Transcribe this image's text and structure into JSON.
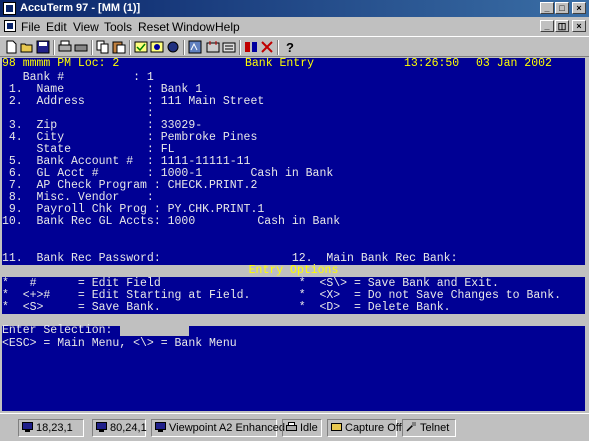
{
  "window": {
    "title": "AccuTerm 97 - [MM (1)]"
  },
  "window_buttons": {
    "minimize": "_",
    "maximize": "□",
    "close": "×"
  },
  "mdi_buttons": {
    "minimize": "_",
    "restore": "◫",
    "close": "×"
  },
  "menu": [
    "File",
    "Edit",
    "View",
    "Tools",
    "Reset",
    "Window",
    "Help"
  ],
  "toolbar": {
    "icons": [
      "new-icon",
      "open-icon",
      "save-icon",
      "print-icon",
      "printer-setup-icon",
      "copy-icon",
      "paste-icon",
      "capture-icon",
      "settings-icon",
      "macro-icon",
      "connect-icon",
      "disconnect-icon",
      "transfer-icon",
      "keyboard-icon",
      "help-icon"
    ]
  },
  "terminal": {
    "status_left": "98 mmmm PM Loc: 2",
    "status_center": "Bank Entry",
    "status_time": "13:26:50",
    "status_date": "03 Jan 2002",
    "lines": [
      "   Bank #          : 1",
      " 1.  Name            : Bank 1",
      " 2.  Address         : 111 Main Street",
      "                     :",
      " 3.  Zip             : 33029-",
      " 4.  City            : Pembroke Pines",
      "     State           : FL",
      " 5.  Bank Account #  : 1111-11111-11",
      " 6.  GL Acct #       : 1000-1       Cash in Bank",
      " 7.  AP Check Program : CHECK.PRINT.2",
      " 8.  Misc. Vendor    :",
      " 9.  Payroll Chk Prog : PY.CHK.PRINT.1",
      "10.  Bank Rec GL Accts: 1000         Cash in Bank"
    ],
    "password_line": "11.  Bank Rec Password:                   12.  Main Bank Rec Bank:",
    "entry_options_title": "Entry Options",
    "options": [
      "*   #      = Edit Field                    *  <S\\> = Save Bank and Exit.",
      "*  <+>#    = Edit Starting at Field.       *  <X>  = Do not Save Changes to Bank.",
      "*  <S>     = Save Bank.                    *  <D>  = Delete Bank."
    ],
    "prompt": "Enter Selection:",
    "selection_value": "",
    "help_line": "<ESC> = Main Menu, <\\> = Bank Menu"
  },
  "statusbar": {
    "cursor_pos": "18,23,1",
    "screen_size": "80,24,1",
    "emulation": "Viewpoint A2 Enhanced",
    "state": "Idle",
    "capture": "Capture Off",
    "protocol": "Telnet"
  },
  "colors": {
    "terminal_bg": "#000094",
    "terminal_fg": "#e8e8e8",
    "highlight": "#ffff00",
    "titlebar": "#0a246a"
  }
}
